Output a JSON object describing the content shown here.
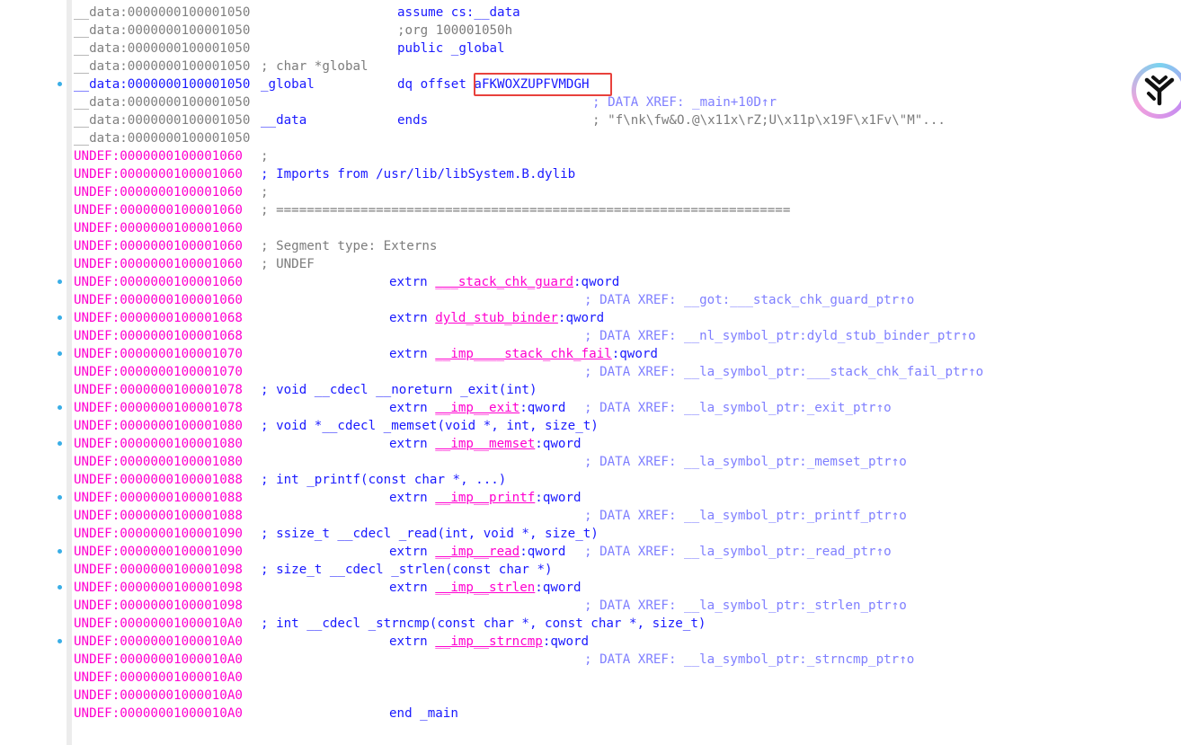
{
  "rows": [
    {
      "seg": "data",
      "addr": "__data:0000000100001050",
      "c1": "",
      "c2": "assume cs:__data",
      "c3": ""
    },
    {
      "seg": "data",
      "addr": "__data:0000000100001050",
      "c1": "",
      "c2": ";org 100001050h",
      "c3": ""
    },
    {
      "seg": "data",
      "addr": "__data:0000000100001050",
      "c1": "",
      "c2": "public _global",
      "c3": ""
    },
    {
      "seg": "data",
      "addr": "__data:0000000100001050",
      "c1": "; char *global",
      "c2": "",
      "c3": ""
    },
    {
      "seg": "data",
      "addr": "__data:0000000100001050",
      "c1": "_global",
      "c2": "dq offset aFKWOXZUPFVMDGH",
      "c3": "",
      "dot": true,
      "hl": true
    },
    {
      "seg": "data",
      "addr": "__data:0000000100001050",
      "c1": "",
      "c2": "",
      "c3": "; DATA XREF: _main+10D↑r"
    },
    {
      "seg": "data",
      "addr": "__data:0000000100001050",
      "c1": "__data",
      "c2": "ends",
      "c3": "; \"f\\nk\\fw&O.@\\x11x\\rZ;U\\x11p\\x19F\\x1Fv\\\"M\"..."
    },
    {
      "seg": "data",
      "addr": "__data:0000000100001050",
      "c1": "",
      "c2": "",
      "c3": ""
    },
    {
      "seg": "undef",
      "addr": "UNDEF:0000000100001060",
      "c1": ";",
      "c2": "",
      "c3": ""
    },
    {
      "seg": "undef",
      "addr": "UNDEF:0000000100001060",
      "c1": "; Imports from /usr/lib/libSystem.B.dylib",
      "c2": "",
      "c3": ""
    },
    {
      "seg": "undef",
      "addr": "UNDEF:0000000100001060",
      "c1": ";",
      "c2": "",
      "c3": ""
    },
    {
      "seg": "undef",
      "addr": "UNDEF:0000000100001060",
      "c1": "; ===================================================================",
      "c2": "",
      "c3": ""
    },
    {
      "seg": "undef",
      "addr": "UNDEF:0000000100001060",
      "c1": "",
      "c2": "",
      "c3": ""
    },
    {
      "seg": "undef",
      "addr": "UNDEF:0000000100001060",
      "c1": "; Segment type: Externs",
      "c2": "",
      "c3": ""
    },
    {
      "seg": "undef",
      "addr": "UNDEF:0000000100001060",
      "c1": "; UNDEF",
      "c2": "",
      "c3": ""
    },
    {
      "seg": "undef",
      "addr": "UNDEF:0000000100001060",
      "c1": "",
      "c2": "extrn ___stack_chk_guard:qword",
      "c3": "",
      "dot": true
    },
    {
      "seg": "undef",
      "addr": "UNDEF:0000000100001060",
      "c1": "",
      "c2": "",
      "c3": "; DATA XREF: __got:___stack_chk_guard_ptr↑o"
    },
    {
      "seg": "undef",
      "addr": "UNDEF:0000000100001068",
      "c1": "",
      "c2": "extrn dyld_stub_binder:qword",
      "c3": "",
      "dot": true
    },
    {
      "seg": "undef",
      "addr": "UNDEF:0000000100001068",
      "c1": "",
      "c2": "",
      "c3": "; DATA XREF: __nl_symbol_ptr:dyld_stub_binder_ptr↑o"
    },
    {
      "seg": "undef",
      "addr": "UNDEF:0000000100001070",
      "c1": "",
      "c2": "extrn __imp____stack_chk_fail:qword",
      "c3": "",
      "dot": true
    },
    {
      "seg": "undef",
      "addr": "UNDEF:0000000100001070",
      "c1": "",
      "c2": "",
      "c3": "; DATA XREF: __la_symbol_ptr:___stack_chk_fail_ptr↑o"
    },
    {
      "seg": "undef",
      "addr": "UNDEF:0000000100001078",
      "c1": "; void __cdecl __noreturn _exit(int)",
      "c2": "",
      "c3": ""
    },
    {
      "seg": "undef",
      "addr": "UNDEF:0000000100001078",
      "c1": "",
      "c2": "extrn __imp__exit:qword",
      "c3": "; DATA XREF: __la_symbol_ptr:_exit_ptr↑o",
      "dot": true
    },
    {
      "seg": "undef",
      "addr": "UNDEF:0000000100001080",
      "c1": "; void *__cdecl _memset(void *, int, size_t)",
      "c2": "",
      "c3": ""
    },
    {
      "seg": "undef",
      "addr": "UNDEF:0000000100001080",
      "c1": "",
      "c2": "extrn __imp__memset:qword",
      "c3": "",
      "dot": true
    },
    {
      "seg": "undef",
      "addr": "UNDEF:0000000100001080",
      "c1": "",
      "c2": "",
      "c3": "; DATA XREF: __la_symbol_ptr:_memset_ptr↑o"
    },
    {
      "seg": "undef",
      "addr": "UNDEF:0000000100001088",
      "c1": "; int _printf(const char *, ...)",
      "c2": "",
      "c3": ""
    },
    {
      "seg": "undef",
      "addr": "UNDEF:0000000100001088",
      "c1": "",
      "c2": "extrn __imp__printf:qword",
      "c3": "",
      "dot": true
    },
    {
      "seg": "undef",
      "addr": "UNDEF:0000000100001088",
      "c1": "",
      "c2": "",
      "c3": "; DATA XREF: __la_symbol_ptr:_printf_ptr↑o"
    },
    {
      "seg": "undef",
      "addr": "UNDEF:0000000100001090",
      "c1": "; ssize_t __cdecl _read(int, void *, size_t)",
      "c2": "",
      "c3": ""
    },
    {
      "seg": "undef",
      "addr": "UNDEF:0000000100001090",
      "c1": "",
      "c2": "extrn __imp__read:qword",
      "c3": "; DATA XREF: __la_symbol_ptr:_read_ptr↑o",
      "dot": true
    },
    {
      "seg": "undef",
      "addr": "UNDEF:0000000100001098",
      "c1": "; size_t __cdecl _strlen(const char *)",
      "c2": "",
      "c3": ""
    },
    {
      "seg": "undef",
      "addr": "UNDEF:0000000100001098",
      "c1": "",
      "c2": "extrn __imp__strlen:qword",
      "c3": "",
      "dot": true
    },
    {
      "seg": "undef",
      "addr": "UNDEF:0000000100001098",
      "c1": "",
      "c2": "",
      "c3": "; DATA XREF: __la_symbol_ptr:_strlen_ptr↑o"
    },
    {
      "seg": "undef",
      "addr": "UNDEF:00000001000010A0",
      "c1": "; int __cdecl _strncmp(const char *, const char *, size_t)",
      "c2": "",
      "c3": ""
    },
    {
      "seg": "undef",
      "addr": "UNDEF:00000001000010A0",
      "c1": "",
      "c2": "extrn __imp__strncmp:qword",
      "c3": "",
      "dot": true
    },
    {
      "seg": "undef",
      "addr": "UNDEF:00000001000010A0",
      "c1": "",
      "c2": "",
      "c3": "; DATA XREF: __la_symbol_ptr:_strncmp_ptr↑o"
    },
    {
      "seg": "undef",
      "addr": "UNDEF:00000001000010A0",
      "c1": "",
      "c2": "",
      "c3": ""
    },
    {
      "seg": "undef",
      "addr": "UNDEF:00000001000010A0",
      "c1": "",
      "c2": "",
      "c3": ""
    },
    {
      "seg": "undef",
      "addr": "UNDEF:00000001000010A0",
      "c1": "",
      "c2": "end _main",
      "c3": ""
    }
  ],
  "highlight": {
    "label": "aFKWOXZUPFVMDGH",
    "box_color": "#e8413c"
  },
  "colors": {
    "data_addr": "#808080",
    "undef_addr": "#ff00d0",
    "highlight_addr": "#1a1aff",
    "keyword": "#1a1aff",
    "comment": "#7c7c7c",
    "xref": "#7f7fff",
    "import_name": "#ff00d0"
  },
  "badge": {
    "icon": "y-logo-icon"
  }
}
